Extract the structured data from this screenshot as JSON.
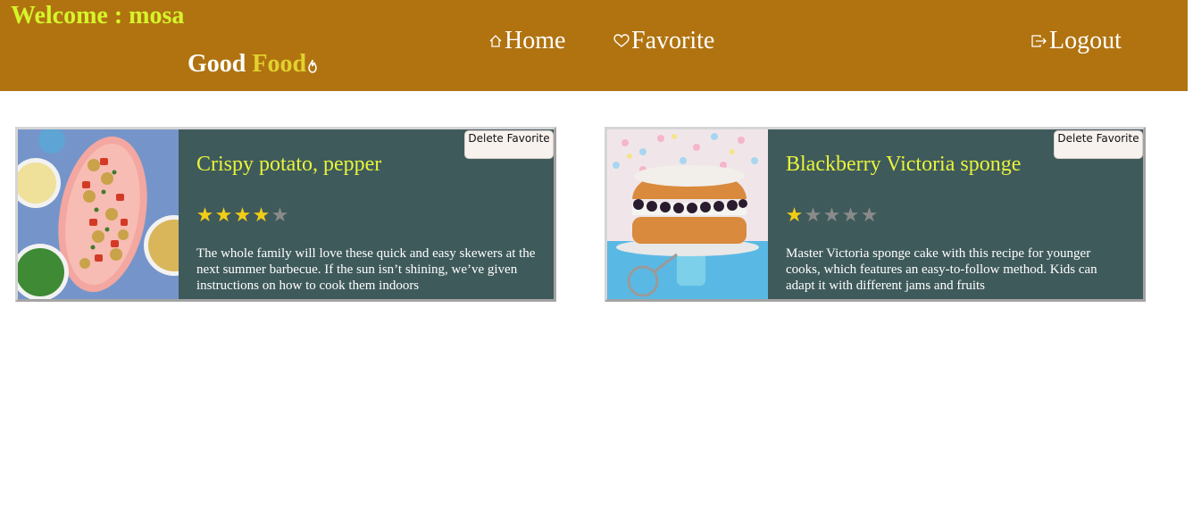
{
  "header": {
    "welcome_label": "Welcome : ",
    "username": "mosa",
    "brand_word1": "Good ",
    "brand_word2": "Food",
    "nav": {
      "home": "Home",
      "favorite": "Favorite",
      "logout": "Logout"
    },
    "colors": {
      "bar": "#b07310",
      "welcome": "#d6f52a",
      "brand_accent": "#e2d22e"
    }
  },
  "favorites": [
    {
      "title": "Crispy potato, pepper",
      "rating": 4,
      "rating_max": 5,
      "description": "The whole family will love these quick and easy skewers at the next summer barbecue. If the sun isn’t shining, we’ve given instructions on how to cook them indoors",
      "delete_label": "Delete Favorite"
    },
    {
      "title": "Blackberry Victoria sponge",
      "rating": 1,
      "rating_max": 5,
      "description": "Master Victoria sponge cake with this recipe for younger cooks, which features an easy-to-follow method. Kids can adapt it with different jams and fruits",
      "delete_label": "Delete Favorite"
    }
  ],
  "colors": {
    "card_bg": "#3f5a5b",
    "title": "#e8f43a",
    "star_on": "#f2cd16",
    "star_off": "#8a8a8a"
  }
}
